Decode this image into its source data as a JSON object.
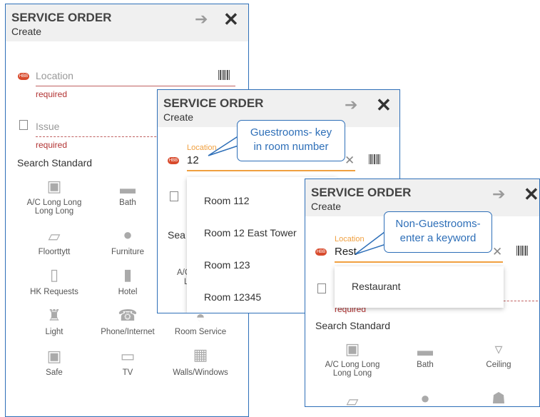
{
  "panel1": {
    "title": "SERVICE ORDER",
    "subtitle": "Create",
    "location_placeholder": "Location",
    "location_required": "required",
    "issue_placeholder": "Issue",
    "issue_required": "required",
    "section_label": "Search Standard",
    "categories": [
      {
        "label": "A/C Long Long Long Long",
        "icon": "ac-icon"
      },
      {
        "label": "Bath",
        "icon": "bathtub-icon"
      },
      {
        "label": "Floorttytt",
        "icon": "floor-icon"
      },
      {
        "label": "Furniture",
        "icon": "armchair-icon"
      },
      {
        "label": "HK Requests",
        "icon": "clipboard-icon"
      },
      {
        "label": "Hotel",
        "icon": "building-icon"
      },
      {
        "label": "Light",
        "icon": "lamp-icon"
      },
      {
        "label": "Phone/Internet",
        "icon": "phone-icon"
      },
      {
        "label": "Room Service",
        "icon": "room-service-icon"
      },
      {
        "label": "Safe",
        "icon": "safe-icon"
      },
      {
        "label": "TV",
        "icon": "tv-icon"
      },
      {
        "label": "Walls/Windows",
        "icon": "window-icon"
      }
    ]
  },
  "panel2": {
    "title": "SERVICE ORDER",
    "subtitle": "Create",
    "location_label": "Location",
    "location_value": "12",
    "callout": "Guestrooms- key in room number",
    "dropdown": [
      "Room 112",
      "Room 12 East Tower",
      "Room 123",
      "Room 12345"
    ],
    "side_fragment": "Sea",
    "ac_fragment": "A/C",
    "l_fragment": "L"
  },
  "panel3": {
    "title": "SERVICE ORDER",
    "subtitle": "Create",
    "location_label": "Location",
    "location_value": "Rest",
    "callout": "Non-Guestrooms- enter a keyword",
    "dropdown": [
      "Restaurant"
    ],
    "required_fragment": "required",
    "section_label": "Search Standard",
    "categories": [
      {
        "label": "A/C Long Long Long Long",
        "icon": "ac-icon"
      },
      {
        "label": "Bath",
        "icon": "bathtub-icon"
      },
      {
        "label": "Ceiling",
        "icon": "ceiling-icon"
      }
    ]
  },
  "colors": {
    "accent": "#2e6fb8",
    "required": "#b23333",
    "focus": "#f0a040",
    "location_icon": "#d84a2c"
  }
}
